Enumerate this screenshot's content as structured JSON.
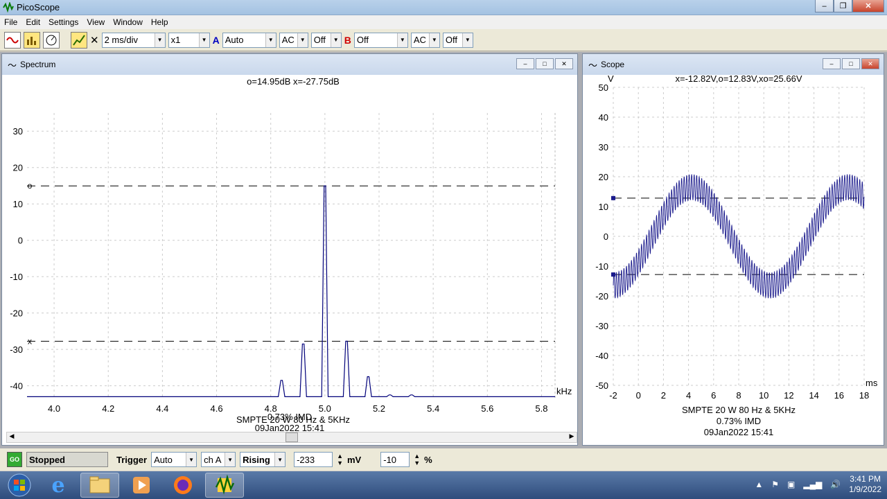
{
  "window": {
    "title": "PicoScope"
  },
  "menu": [
    "File",
    "Edit",
    "Settings",
    "View",
    "Window",
    "Help"
  ],
  "toolbar": {
    "timebase": "2 ms/div",
    "multiplier": "x1",
    "channel_a_label": "A",
    "channel_a_range": "Auto",
    "channel_a_coupling": "AC",
    "channel_a_filter": "Off",
    "channel_b_label": "B",
    "channel_b_range": "Off",
    "channel_b_coupling": "AC",
    "channel_b_filter": "Off"
  },
  "spectrum": {
    "title": "Spectrum",
    "readout": "o=14.95dB  x=-27.75dB",
    "x_unit": "kHz",
    "caption": [
      "SMPTE 20 W 80 Hz & 5KHz",
      "0.73% IMD",
      "09Jan2022  15:41"
    ],
    "marker_o": "o",
    "marker_x": "x"
  },
  "scope": {
    "title": "Scope",
    "y_unit": "V",
    "readout": "x=-12.82V,o=12.83V,xo=25.66V",
    "x_unit": "ms",
    "caption": [
      "SMPTE 20 W 80 Hz & 5KHz",
      "0.73% IMD",
      "09Jan2022  15:41"
    ]
  },
  "chart_data": [
    {
      "type": "line",
      "title": "",
      "xlabel": "kHz",
      "ylabel": "",
      "xlim": [
        3.9,
        5.85
      ],
      "ylim": [
        -43.5,
        35
      ],
      "x_ticks": [
        "4.0",
        "4.2",
        "4.4",
        "4.6",
        "4.8",
        "5.0",
        "5.2",
        "5.4",
        "5.6",
        "5.8"
      ],
      "y_ticks": [
        "30",
        "20",
        "10",
        "0",
        "-10",
        "-20",
        "-30",
        "-40"
      ],
      "grid": true,
      "peaks": [
        {
          "x": 4.84,
          "y": -38.5
        },
        {
          "x": 4.92,
          "y": -28.5
        },
        {
          "x": 5.0,
          "y": 14.95
        },
        {
          "x": 5.08,
          "y": -27.75
        },
        {
          "x": 5.16,
          "y": -37.5
        },
        {
          "x": 5.24,
          "y": -42.5
        },
        {
          "x": 5.32,
          "y": -42.5
        }
      ],
      "cursors": [
        {
          "name": "o",
          "y": 14.95
        },
        {
          "name": "x",
          "y": -27.75
        }
      ]
    },
    {
      "type": "line",
      "title": "",
      "xlabel": "ms",
      "ylabel": "V",
      "xlim": [
        -2,
        18
      ],
      "ylim": [
        -50,
        50
      ],
      "x_ticks": [
        "-2",
        "0",
        "2",
        "4",
        "6",
        "8",
        "10",
        "12",
        "14",
        "16",
        "18"
      ],
      "y_ticks": [
        "50",
        "40",
        "30",
        "20",
        "10",
        "0",
        "-10",
        "-20",
        "-30",
        "-40",
        "-50"
      ],
      "grid": true,
      "signal": {
        "low_freq_hz": 80,
        "low_amp_v": 16.5,
        "high_freq_khz": 5,
        "high_amp_v": 4.3,
        "start_phase_deg": -90
      },
      "cursors": [
        {
          "name": "o",
          "y": 12.83
        },
        {
          "name": "x",
          "y": -12.82
        }
      ]
    }
  ],
  "status": {
    "go_label": "GO",
    "state": "Stopped",
    "trigger_label": "Trigger",
    "trigger_mode": "Auto",
    "trigger_channel": "ch A",
    "trigger_edge": "Rising",
    "trigger_level": "-233",
    "trigger_level_unit": "mV",
    "pretrigger": "-10",
    "pretrigger_unit": "%"
  },
  "taskbar": {
    "time": "3:41 PM",
    "date": "1/9/2022"
  }
}
